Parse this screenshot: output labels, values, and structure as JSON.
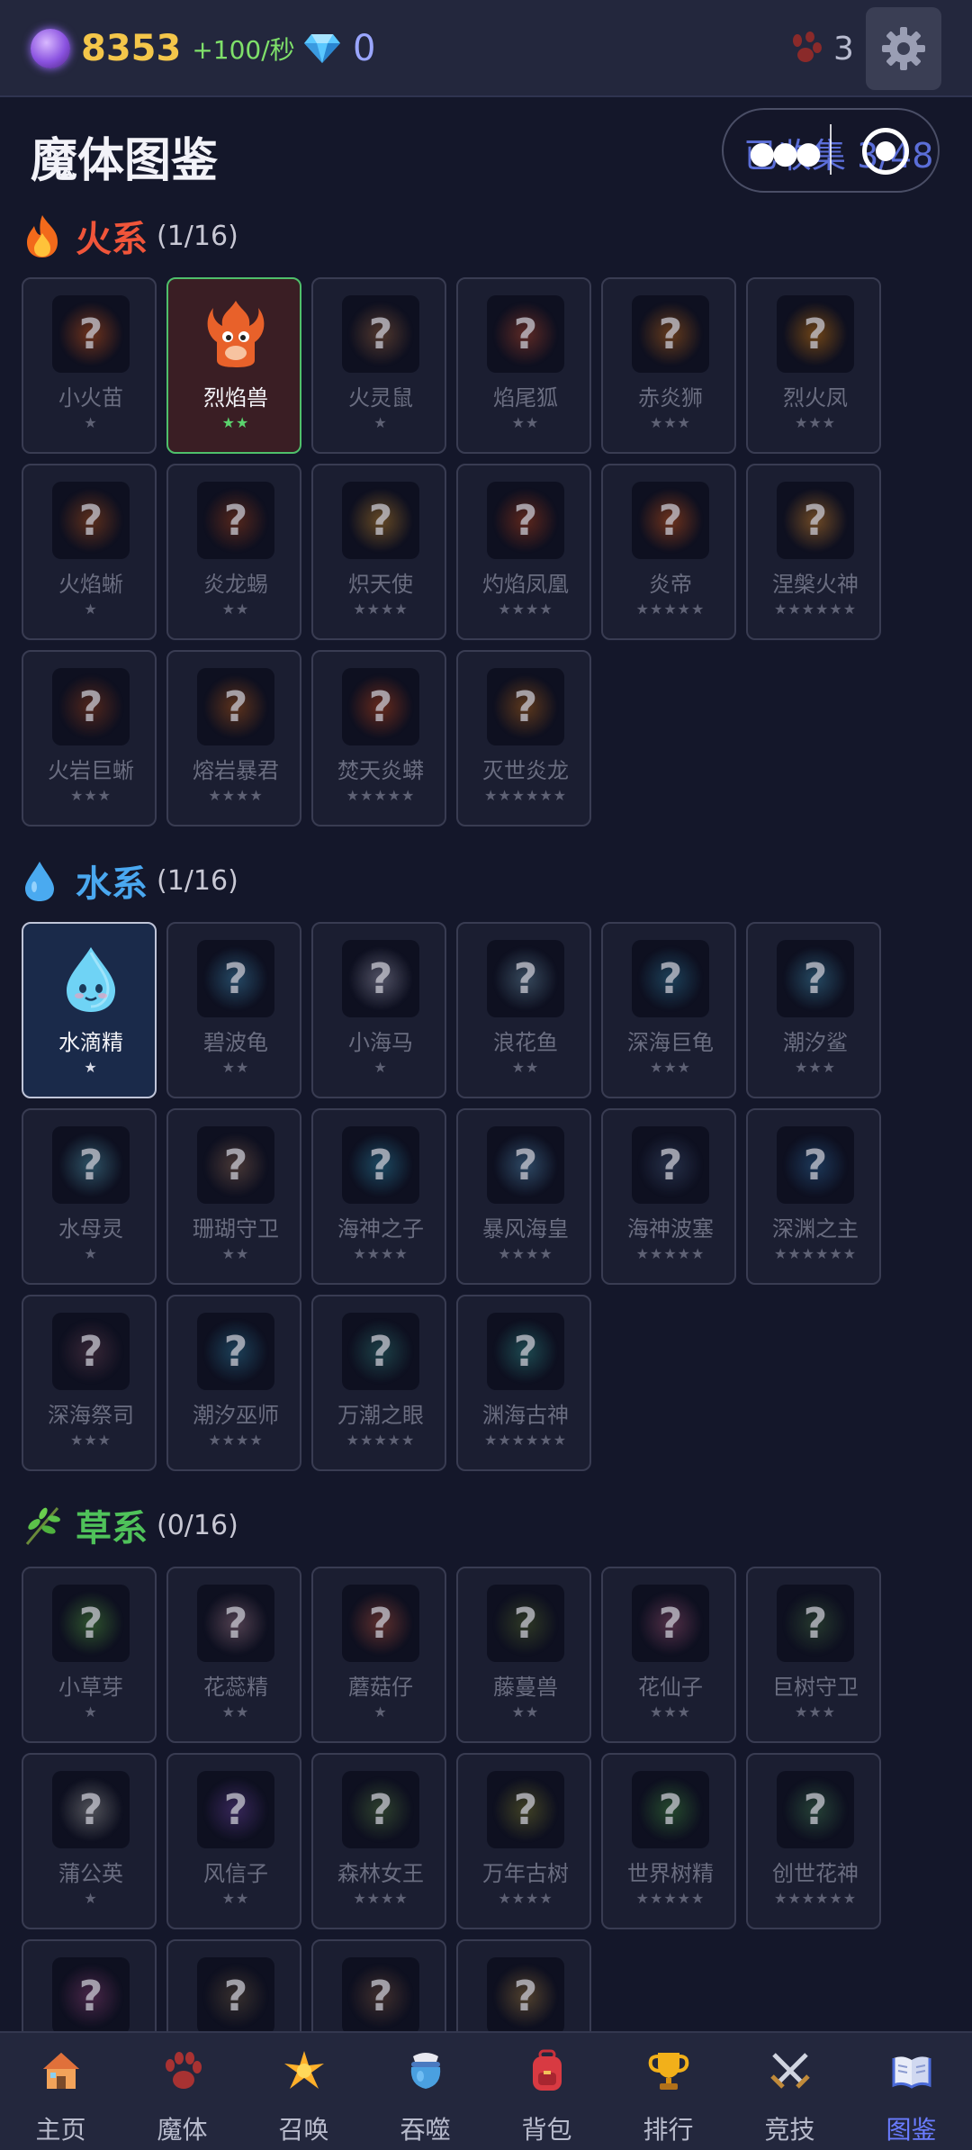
{
  "topbar": {
    "orb_value": "8353",
    "orb_rate": "+100/秒",
    "gem_value": "0",
    "paw_count": "3"
  },
  "header": {
    "title": "魔体图鉴",
    "collected": "已收集 3/48"
  },
  "sections": [
    {
      "name": "火系",
      "count": "(1/16)",
      "color": "#f0553a",
      "icon": "fire-icon",
      "cards": [
        {
          "name": "小火苗",
          "stars": "★",
          "owned": false,
          "tint": "#c0501a"
        },
        {
          "name": "烈焰兽",
          "stars": "★★",
          "owned": true,
          "tint": "#e05a2a"
        },
        {
          "name": "火灵鼠",
          "stars": "★",
          "owned": false,
          "tint": "#8a5a3a"
        },
        {
          "name": "焰尾狐",
          "stars": "★★",
          "owned": false,
          "tint": "#a0402a"
        },
        {
          "name": "赤炎狮",
          "stars": "★★★",
          "owned": false,
          "tint": "#b0601a"
        },
        {
          "name": "烈火凤",
          "stars": "★★★",
          "owned": false,
          "tint": "#c07010"
        },
        {
          "name": "火焰蜥",
          "stars": "★",
          "owned": false,
          "tint": "#a04a1a"
        },
        {
          "name": "炎龙蜴",
          "stars": "★★",
          "owned": false,
          "tint": "#903a1a"
        },
        {
          "name": "炽天使",
          "stars": "★★★★",
          "owned": false,
          "tint": "#b07a2a"
        },
        {
          "name": "灼焰凤凰",
          "stars": "★★★★",
          "owned": false,
          "tint": "#a03a1a"
        },
        {
          "name": "炎帝",
          "stars": "★★★★★",
          "owned": false,
          "tint": "#c0501a"
        },
        {
          "name": "涅槃火神",
          "stars": "★★★★★★",
          "owned": false,
          "tint": "#c07a2a"
        },
        {
          "name": "火岩巨蜥",
          "stars": "★★★",
          "owned": false,
          "tint": "#8a3a1a"
        },
        {
          "name": "熔岩暴君",
          "stars": "★★★★",
          "owned": false,
          "tint": "#a0501a"
        },
        {
          "name": "焚天炎蟒",
          "stars": "★★★★★",
          "owned": false,
          "tint": "#b0401a"
        },
        {
          "name": "灭世炎龙",
          "stars": "★★★★★★",
          "owned": false,
          "tint": "#a05a1a"
        }
      ]
    },
    {
      "name": "水系",
      "count": "(1/16)",
      "color": "#4aa8f0",
      "icon": "water-drop-icon",
      "cards": [
        {
          "name": "水滴精",
          "stars": "★",
          "owned": true,
          "tint": "#5ac8f0"
        },
        {
          "name": "碧波龟",
          "stars": "★★",
          "owned": false,
          "tint": "#3a7aa0"
        },
        {
          "name": "小海马",
          "stars": "★",
          "owned": false,
          "tint": "#8a8aa0"
        },
        {
          "name": "浪花鱼",
          "stars": "★★",
          "owned": false,
          "tint": "#5a7a90"
        },
        {
          "name": "深海巨龟",
          "stars": "★★★",
          "owned": false,
          "tint": "#2a6a8a"
        },
        {
          "name": "潮汐鲨",
          "stars": "★★★",
          "owned": false,
          "tint": "#3a7a9a"
        },
        {
          "name": "水母灵",
          "stars": "★",
          "owned": false,
          "tint": "#4a8aa0"
        },
        {
          "name": "珊瑚守卫",
          "stars": "★★",
          "owned": false,
          "tint": "#7a5a4a"
        },
        {
          "name": "海神之子",
          "stars": "★★★★",
          "owned": false,
          "tint": "#2a7a9a"
        },
        {
          "name": "暴风海皇",
          "stars": "★★★★",
          "owned": false,
          "tint": "#4a7aa0"
        },
        {
          "name": "海神波塞",
          "stars": "★★★★★",
          "owned": false,
          "tint": "#3a4a6a"
        },
        {
          "name": "深渊之主",
          "stars": "★★★★★★",
          "owned": false,
          "tint": "#2a5a8a"
        },
        {
          "name": "深海祭司",
          "stars": "★★★",
          "owned": false,
          "tint": "#5a3a4a"
        },
        {
          "name": "潮汐巫师",
          "stars": "★★★★",
          "owned": false,
          "tint": "#2a6a8a"
        },
        {
          "name": "万潮之眼",
          "stars": "★★★★★",
          "owned": false,
          "tint": "#2a6a6a"
        },
        {
          "name": "渊海古神",
          "stars": "★★★★★★",
          "owned": false,
          "tint": "#2a7a7a"
        }
      ]
    },
    {
      "name": "草系",
      "count": "(0/16)",
      "color": "#4fc25a",
      "icon": "herb-icon",
      "cards": [
        {
          "name": "小草芽",
          "stars": "★",
          "owned": false,
          "tint": "#4a8a3a"
        },
        {
          "name": "花蕊精",
          "stars": "★★",
          "owned": false,
          "tint": "#8a6a7a"
        },
        {
          "name": "蘑菇仔",
          "stars": "★",
          "owned": false,
          "tint": "#a04a3a"
        },
        {
          "name": "藤蔓兽",
          "stars": "★★",
          "owned": false,
          "tint": "#4a5a2a"
        },
        {
          "name": "花仙子",
          "stars": "★★★",
          "owned": false,
          "tint": "#8a4a6a"
        },
        {
          "name": "巨树守卫",
          "stars": "★★★",
          "owned": false,
          "tint": "#3a5a3a"
        },
        {
          "name": "蒲公英",
          "stars": "★",
          "owned": false,
          "tint": "#8a8a8a"
        },
        {
          "name": "风信子",
          "stars": "★★",
          "owned": false,
          "tint": "#5a3a8a"
        },
        {
          "name": "森林女王",
          "stars": "★★★★",
          "owned": false,
          "tint": "#4a6a3a"
        },
        {
          "name": "万年古树",
          "stars": "★★★★",
          "owned": false,
          "tint": "#6a6a2a"
        },
        {
          "name": "世界树精",
          "stars": "★★★★★",
          "owned": false,
          "tint": "#3a7a3a"
        },
        {
          "name": "创世花神",
          "stars": "★★★★★★",
          "owned": false,
          "tint": "#3a6a4a"
        },
        {
          "name": "",
          "stars": "",
          "owned": false,
          "tint": "#7a3a6a"
        },
        {
          "name": "",
          "stars": "",
          "owned": false,
          "tint": "#5a4a3a"
        },
        {
          "name": "",
          "stars": "",
          "owned": false,
          "tint": "#6a4a3a"
        },
        {
          "name": "",
          "stars": "",
          "owned": false,
          "tint": "#8a6a3a"
        }
      ]
    }
  ],
  "nav": [
    {
      "label": "主页",
      "icon": "house-icon",
      "active": false
    },
    {
      "label": "魔体",
      "icon": "paw-icon",
      "active": false
    },
    {
      "label": "召唤",
      "icon": "sparkle-icon",
      "active": false
    },
    {
      "label": "吞噬",
      "icon": "cauldron-icon",
      "active": false
    },
    {
      "label": "背包",
      "icon": "backpack-icon",
      "active": false
    },
    {
      "label": "排行",
      "icon": "trophy-icon",
      "active": false
    },
    {
      "label": "竞技",
      "icon": "crossed-swords-icon",
      "active": false
    },
    {
      "label": "图鉴",
      "icon": "book-icon",
      "active": true
    }
  ]
}
